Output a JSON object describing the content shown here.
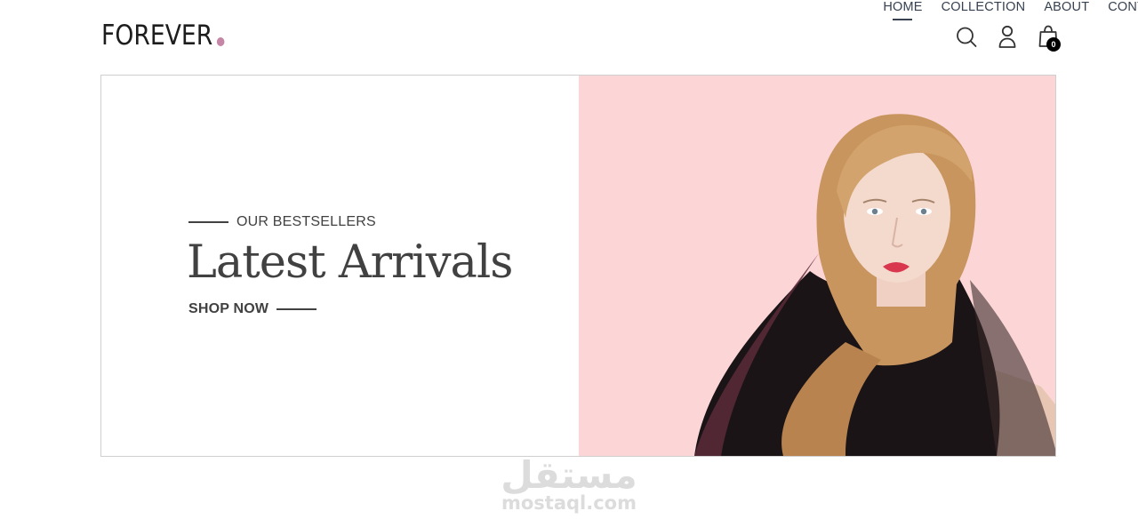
{
  "brand": {
    "name": "FOREVER",
    "dot_color": "#c586a5"
  },
  "nav": {
    "items": [
      {
        "label": "HOME",
        "active": true
      },
      {
        "label": "COLLECTION",
        "active": false
      },
      {
        "label": "ABOUT",
        "active": false
      },
      {
        "label": "CONTACT",
        "active": false
      }
    ]
  },
  "header_icons": {
    "search": "search-icon",
    "profile": "user-icon",
    "cart": "bag-icon",
    "cart_count": "0"
  },
  "hero": {
    "eyebrow": "OUR BESTSELLERS",
    "title": "Latest Arrivals",
    "cta": "SHOP NOW",
    "image_bg": "#fcd6d6"
  },
  "watermark": {
    "arabic": "مستقل",
    "latin": "mostaql.com"
  }
}
